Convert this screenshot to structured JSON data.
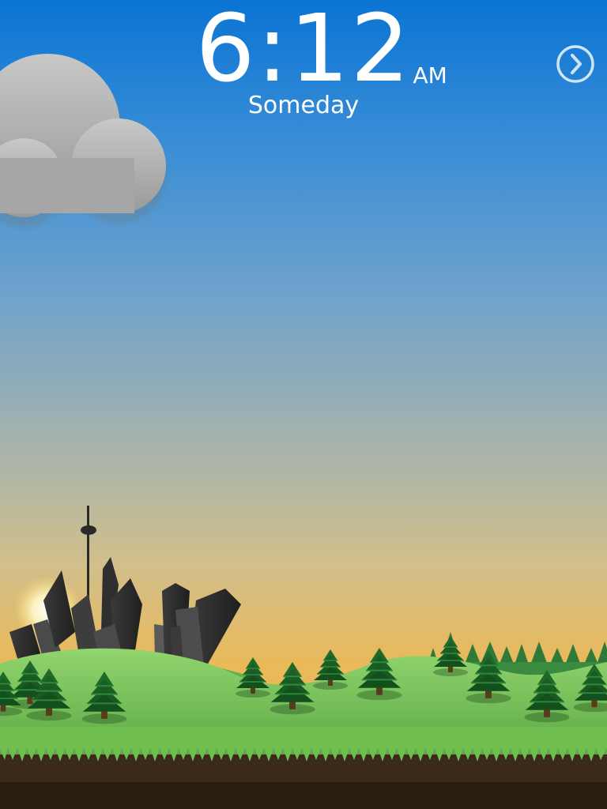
{
  "clock": {
    "time": "6:12",
    "meridiem": "AM"
  },
  "day": "Someday",
  "next_button": {
    "icon": "chevron-right-icon"
  },
  "colors": {
    "sky_top": "#0a74d4",
    "sky_bottom": "#f2b446",
    "grass": "#8fd06a",
    "soil": "#3b2a1a"
  }
}
